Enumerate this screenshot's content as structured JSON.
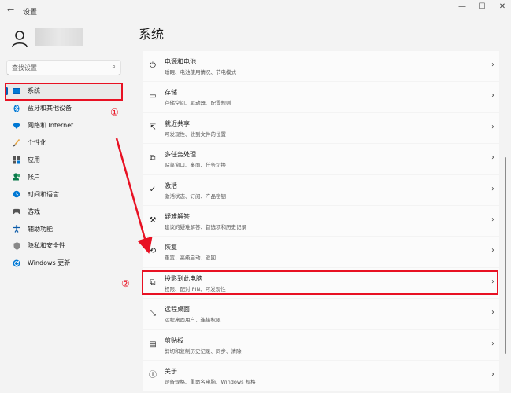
{
  "window": {
    "title": "设置",
    "back_icon": "back-arrow-icon",
    "min_glyph": "—",
    "max_glyph": "☐",
    "close_glyph": "✕"
  },
  "search": {
    "placeholder": "查找设置",
    "icon": "search-icon"
  },
  "sidebar": {
    "items": [
      {
        "label": "系统",
        "icon": "system-monitor-icon",
        "active": true
      },
      {
        "label": "蓝牙和其他设备",
        "icon": "bluetooth-icon"
      },
      {
        "label": "网络和 Internet",
        "icon": "wifi-icon"
      },
      {
        "label": "个性化",
        "icon": "brush-icon"
      },
      {
        "label": "应用",
        "icon": "apps-icon"
      },
      {
        "label": "帐户",
        "icon": "account-icon"
      },
      {
        "label": "时间和语言",
        "icon": "globe-clock-icon"
      },
      {
        "label": "游戏",
        "icon": "gamepad-icon"
      },
      {
        "label": "辅助功能",
        "icon": "accessibility-icon"
      },
      {
        "label": "隐私和安全性",
        "icon": "shield-icon"
      },
      {
        "label": "Windows 更新",
        "icon": "update-icon"
      }
    ]
  },
  "main": {
    "title": "系统",
    "rows": [
      {
        "title": "电源和电池",
        "subtitle": "睡眠、电池使用情况、节电模式",
        "icon": "power-icon"
      },
      {
        "title": "存储",
        "subtitle": "存储空间、驱动器、配置规则",
        "icon": "storage-icon"
      },
      {
        "title": "就近共享",
        "subtitle": "可发现性、收到文件的位置",
        "icon": "share-icon"
      },
      {
        "title": "多任务处理",
        "subtitle": "贴靠窗口、桌面、任务切换",
        "icon": "multitask-icon"
      },
      {
        "title": "激活",
        "subtitle": "激活状态、订阅、产品密钥",
        "icon": "check-circle-icon"
      },
      {
        "title": "疑难解答",
        "subtitle": "建议的疑难解答、首选项和历史记录",
        "icon": "wrench-icon"
      },
      {
        "title": "恢复",
        "subtitle": "重置、高级启动、返回",
        "icon": "recovery-icon"
      },
      {
        "title": "投影到此电脑",
        "subtitle": "权限、配对 PIN、可发现性",
        "icon": "project-icon"
      },
      {
        "title": "远程桌面",
        "subtitle": "远程桌面用户、连接权限",
        "icon": "remote-desktop-icon"
      },
      {
        "title": "剪贴板",
        "subtitle": "剪切和复制历史记录、同步、清除",
        "icon": "clipboard-icon"
      },
      {
        "title": "关于",
        "subtitle": "设备规格、重命名电脑、Windows 规格",
        "icon": "info-icon"
      }
    ]
  },
  "annotations": {
    "marker1": "①",
    "marker2": "②",
    "color": "#e81123"
  },
  "colors": {
    "accent": "#005fb8",
    "annotation_red": "#e81123",
    "background": "#f3f3f3",
    "card": "#fbfbfb"
  }
}
